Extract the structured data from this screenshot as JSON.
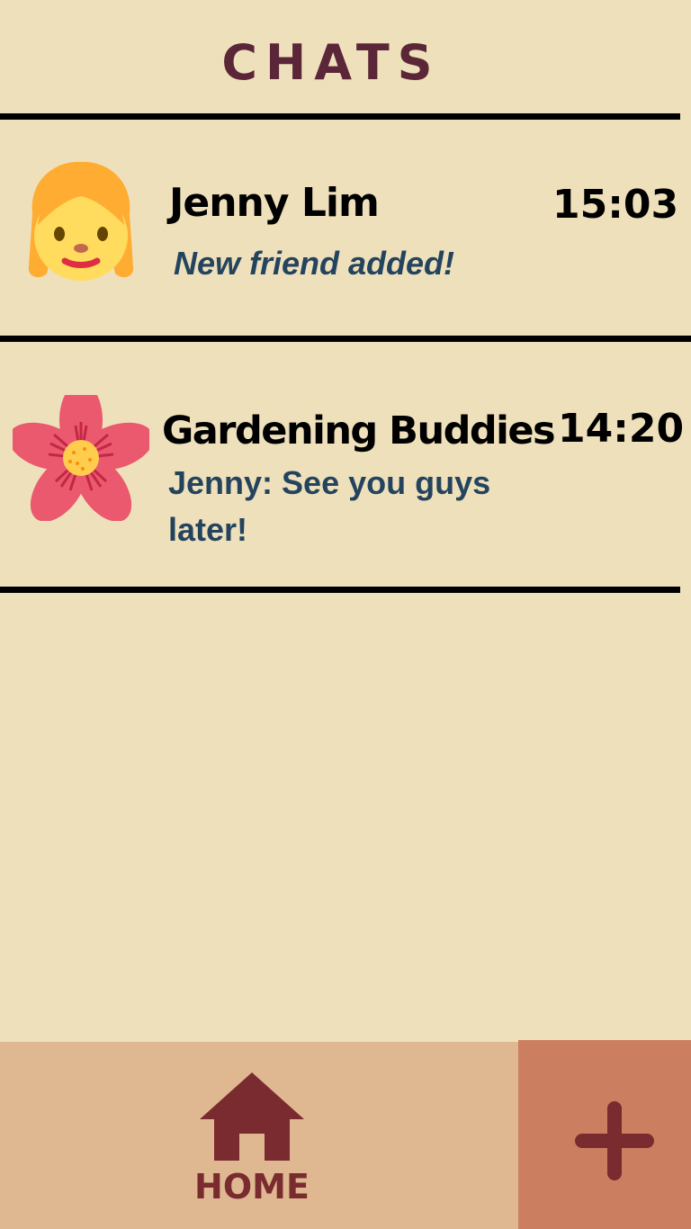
{
  "header": {
    "title": "CHATS"
  },
  "chats": [
    {
      "name": "Jenny Lim",
      "time": "15:03",
      "preview": "New friend added!",
      "avatar_icon": "girl-emoji-icon"
    },
    {
      "name": "Gardening Buddies",
      "time": "14:20",
      "preview": "Jenny: See you guys later!",
      "avatar_icon": "flower-icon"
    }
  ],
  "bottom_nav": {
    "home_label": "HOME",
    "home_icon": "home-icon",
    "add_icon": "plus-icon"
  },
  "colors": {
    "background": "#efe0bc",
    "title": "#5a2638",
    "preview_text": "#24445e",
    "nav_bar": "#dfb891",
    "add_button": "#cb7f60",
    "nav_icon": "#7a2b2f"
  }
}
